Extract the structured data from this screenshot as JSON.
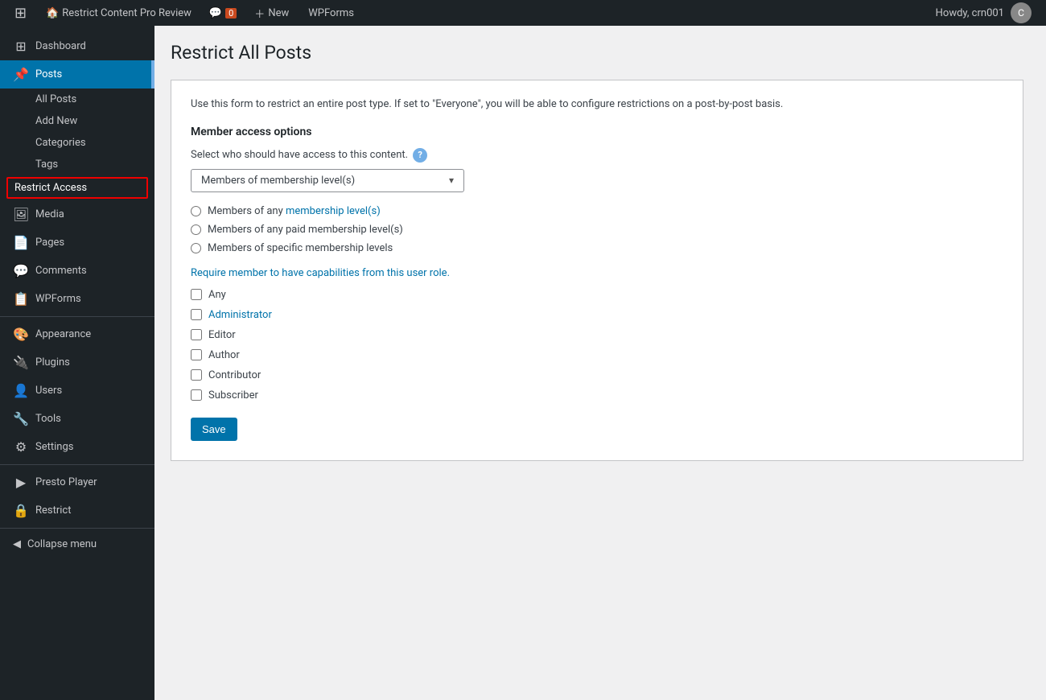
{
  "adminbar": {
    "wp_logo": "⊞",
    "site_name": "Restrict Content Pro Review",
    "comments_label": "Comments",
    "comment_count": "0",
    "new_label": "+ New",
    "new_item": "New",
    "wpforms_label": "WPForms",
    "howdy_text": "Howdy, crn001",
    "avatar_initials": "C"
  },
  "sidebar": {
    "items": [
      {
        "id": "dashboard",
        "label": "Dashboard",
        "icon": "⊞"
      },
      {
        "id": "posts",
        "label": "Posts",
        "icon": "📝",
        "active": true
      },
      {
        "id": "media",
        "label": "Media",
        "icon": "🖼"
      },
      {
        "id": "pages",
        "label": "Pages",
        "icon": "📄"
      },
      {
        "id": "comments",
        "label": "Comments",
        "icon": "💬"
      },
      {
        "id": "wpforms",
        "label": "WPForms",
        "icon": "📋"
      },
      {
        "id": "appearance",
        "label": "Appearance",
        "icon": "🎨"
      },
      {
        "id": "plugins",
        "label": "Plugins",
        "icon": "🔌"
      },
      {
        "id": "users",
        "label": "Users",
        "icon": "👤"
      },
      {
        "id": "tools",
        "label": "Tools",
        "icon": "🔧"
      },
      {
        "id": "settings",
        "label": "Settings",
        "icon": "⚙"
      }
    ],
    "posts_submenu": [
      {
        "id": "all-posts",
        "label": "All Posts"
      },
      {
        "id": "add-new",
        "label": "Add New"
      },
      {
        "id": "categories",
        "label": "Categories"
      },
      {
        "id": "tags",
        "label": "Tags"
      },
      {
        "id": "restrict-access",
        "label": "Restrict Access"
      }
    ],
    "bottom_items": [
      {
        "id": "presto-player",
        "label": "Presto Player",
        "icon": "▶"
      },
      {
        "id": "restrict",
        "label": "Restrict",
        "icon": "🔒"
      }
    ],
    "collapse_label": "Collapse menu",
    "collapse_icon": "◀"
  },
  "main": {
    "page_title": "Restrict All Posts",
    "description": "Use this form to restrict an entire post type. If set to \"Everyone\", you will be able to configure restrictions on a post-by-post basis.",
    "member_access_title": "Member access options",
    "select_label": "Select who should have access to this content.",
    "dropdown_value": "Members of membership level(s)",
    "radio_options": [
      {
        "id": "any-level",
        "label_plain": "Members of any ",
        "label_link": "membership level(s)",
        "checked": false
      },
      {
        "id": "paid-level",
        "label": "Members of any paid membership level(s)",
        "checked": false
      },
      {
        "id": "specific-level",
        "label": "Members of specific membership levels",
        "checked": false
      }
    ],
    "capabilities_text_before": "Require member to have capabilities from this ",
    "capabilities_link": "user role",
    "capabilities_text_after": ".",
    "checkbox_options": [
      {
        "id": "any",
        "label": "Any",
        "checked": false
      },
      {
        "id": "administrator",
        "label": "Administrator",
        "checked": false,
        "link": true
      },
      {
        "id": "editor",
        "label": "Editor",
        "checked": false
      },
      {
        "id": "author",
        "label": "Author",
        "checked": false
      },
      {
        "id": "contributor",
        "label": "Contributor",
        "checked": false
      },
      {
        "id": "subscriber",
        "label": "Subscriber",
        "checked": false
      }
    ],
    "save_button_label": "Save"
  }
}
